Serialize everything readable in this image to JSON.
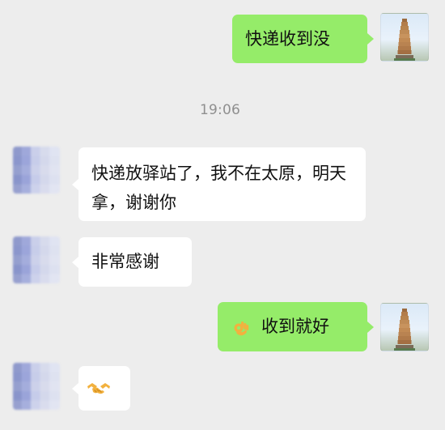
{
  "chat": {
    "time": "19:06",
    "messages": [
      {
        "side": "right",
        "text": "快递收到没"
      },
      {
        "side": "left",
        "text": "快递放驿站了，我不在太原，明天拿，谢谢你"
      },
      {
        "side": "left",
        "text": "非常感谢"
      },
      {
        "side": "right",
        "text": "收到就好",
        "icon": "ok-hand-icon"
      },
      {
        "side": "left",
        "icon": "handshake-icon"
      }
    ]
  },
  "colors": {
    "background": "#ededed",
    "sent_bubble": "#95ec69",
    "received_bubble": "#ffffff",
    "timestamp": "#8f8f8f"
  }
}
